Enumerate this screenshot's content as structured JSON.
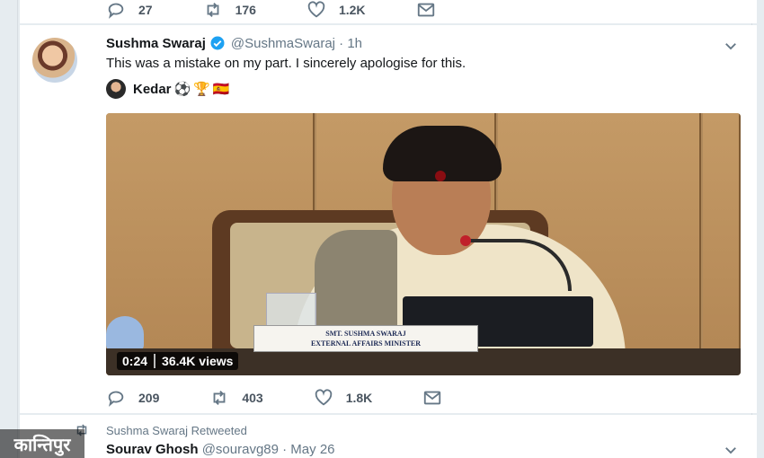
{
  "top_tweet_actions": {
    "reply_count": "27",
    "retweet_count": "176",
    "like_count": "1.2K"
  },
  "tweet": {
    "author_name": "Sushma Swaraj",
    "handle_time": "@SushmaSwaraj · 1h",
    "text": "This was a mistake on my part. I sincerely apologise for this.",
    "mention_name": "Kedar",
    "mention_emojis": [
      "⚽",
      "🏆",
      "🇪🇸"
    ],
    "video": {
      "duration": "0:24",
      "views": "36.4K views",
      "nameplate_line1": "SMT. SUSHMA SWARAJ",
      "nameplate_line2": "EXTERNAL AFFAIRS MINISTER"
    },
    "actions": {
      "reply_count": "209",
      "retweet_count": "403",
      "like_count": "1.8K"
    }
  },
  "next_tweet": {
    "retweeted_by": "Sushma Swaraj Retweeted",
    "author_name": "Sourav Ghosh",
    "handle_time": "@souravg89 · May 26"
  },
  "watermark": "कान्तिपुर",
  "colors": {
    "background": "#e6ecf0",
    "card": "#ffffff",
    "muted_text": "#657786",
    "verified_blue": "#1da1f2"
  },
  "icons": [
    "reply-icon",
    "retweet-icon",
    "like-icon",
    "message-icon",
    "verified-icon",
    "chevron-down-icon"
  ]
}
